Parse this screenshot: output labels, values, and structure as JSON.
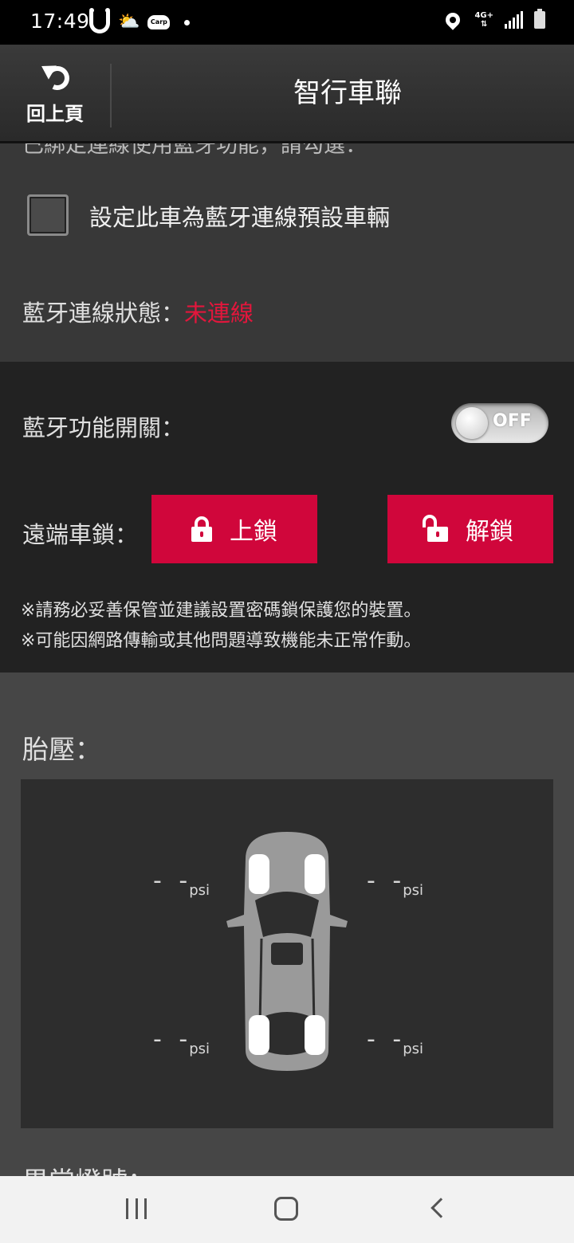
{
  "status_bar": {
    "time": "17:49",
    "network": "4G+",
    "carp_badge": "Carp"
  },
  "header": {
    "back_label": "回上頁",
    "title": "智行車聯"
  },
  "bluetooth_section": {
    "cut_text": "已綁定連線使用藍牙功能，請勾選：",
    "default_vehicle_checkbox": {
      "label": "設定此車為藍牙連線預設車輛",
      "checked": false
    },
    "status_label": "藍牙連線狀態：",
    "status_value": "未連線",
    "status_color": "#e3163c"
  },
  "control_section": {
    "bt_switch_label": "藍牙功能開關：",
    "bt_switch_state": "OFF",
    "remote_lock_label": "遠端車鎖：",
    "lock_button": "上鎖",
    "unlock_button": "解鎖",
    "button_color": "#d0063b",
    "notes": [
      "※請務必妥善保管並建議設置密碼鎖保護您的裝置。",
      "※可能因網路傳輸或其他問題導致機能未正常作動。"
    ]
  },
  "tire_section": {
    "title": "胎壓：",
    "tires": [
      {
        "position": "front-left",
        "value": "- -",
        "unit": "psi"
      },
      {
        "position": "front-right",
        "value": "- -",
        "unit": "psi"
      },
      {
        "position": "rear-left",
        "value": "- -",
        "unit": "psi"
      },
      {
        "position": "rear-right",
        "value": "- -",
        "unit": "psi"
      }
    ]
  },
  "next_section": {
    "title": "異常燈號："
  }
}
